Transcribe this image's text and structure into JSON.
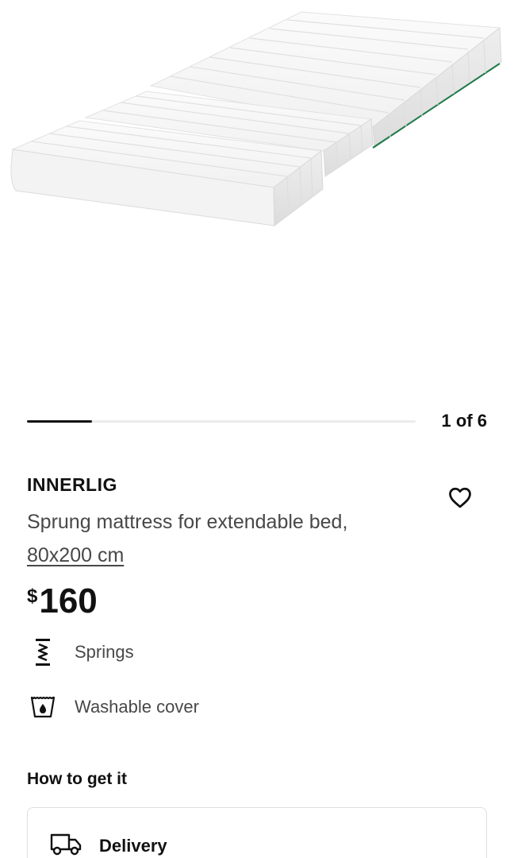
{
  "gallery": {
    "counter": "1 of 6",
    "progress": 0.167
  },
  "product": {
    "name": "INNERLIG",
    "description": "Sprung mattress for extendable bed,",
    "size": "80x200 cm",
    "price_currency": "$",
    "price_amount": "160"
  },
  "features": [
    {
      "icon": "springs-icon",
      "label": "Springs"
    },
    {
      "icon": "washable-icon",
      "label": "Washable cover"
    }
  ],
  "how_to_get": {
    "title": "How to get it",
    "delivery_label": "Delivery"
  },
  "icons": {
    "favourite": "heart-icon",
    "delivery": "truck-icon"
  },
  "colors": {
    "text": "#111111",
    "secondary_text": "#484848",
    "mattress_accent": "#1e7a4a"
  }
}
